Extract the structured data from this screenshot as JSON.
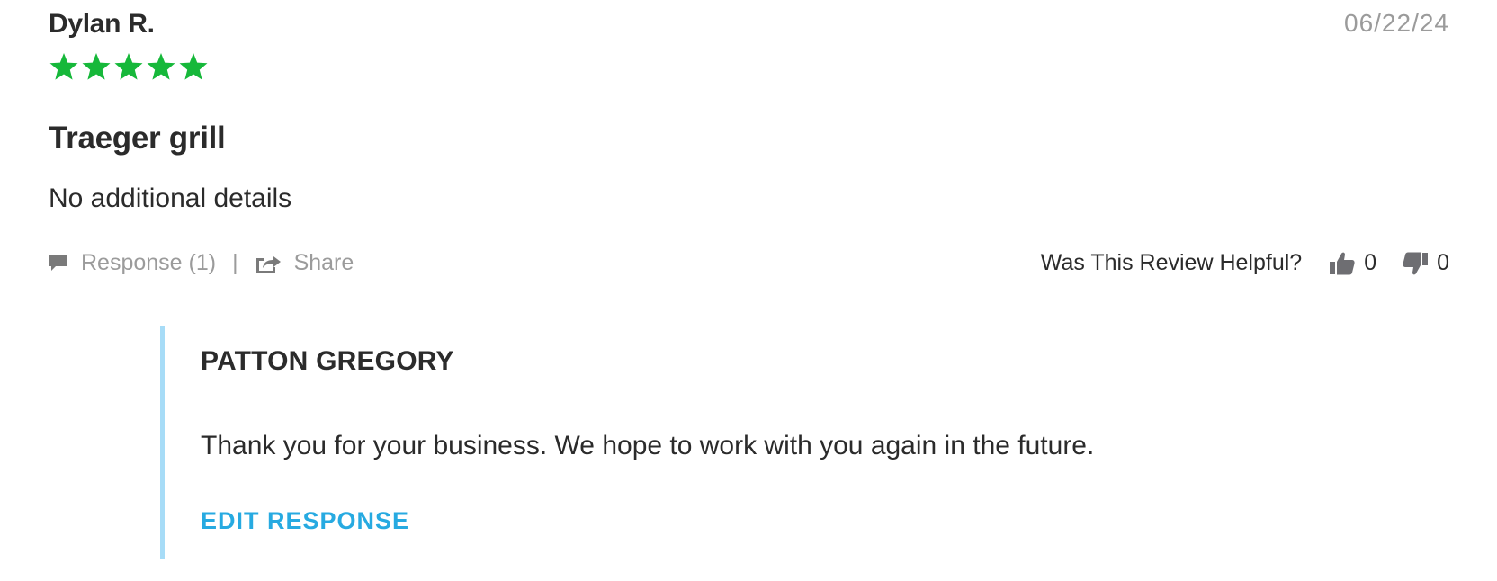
{
  "review": {
    "reviewer_name": "Dylan R.",
    "date": "06/22/24",
    "rating": 5,
    "max_rating": 5,
    "title": "Traeger grill",
    "body": "No additional details"
  },
  "actions": {
    "response_label": "Response (1)",
    "divider": "|",
    "share_label": "Share",
    "helpful_label": "Was This Review Helpful?",
    "thumbs_up_count": "0",
    "thumbs_down_count": "0"
  },
  "response": {
    "responder_name": "PATTON GREGORY",
    "text": "Thank you for your business. We hope to work with you again in the future.",
    "edit_label": "EDIT RESPONSE"
  },
  "icons": {
    "star": "star-icon",
    "response": "speech-bubble-icon",
    "share": "share-icon",
    "thumbs_up": "thumbs-up-icon",
    "thumbs_down": "thumbs-down-icon"
  },
  "colors": {
    "star": "#16b83a",
    "accent_link": "#27aae1",
    "response_border": "#a7dcf7",
    "muted_text": "#9b9b9b",
    "icon_gray": "#7a7a7a"
  }
}
